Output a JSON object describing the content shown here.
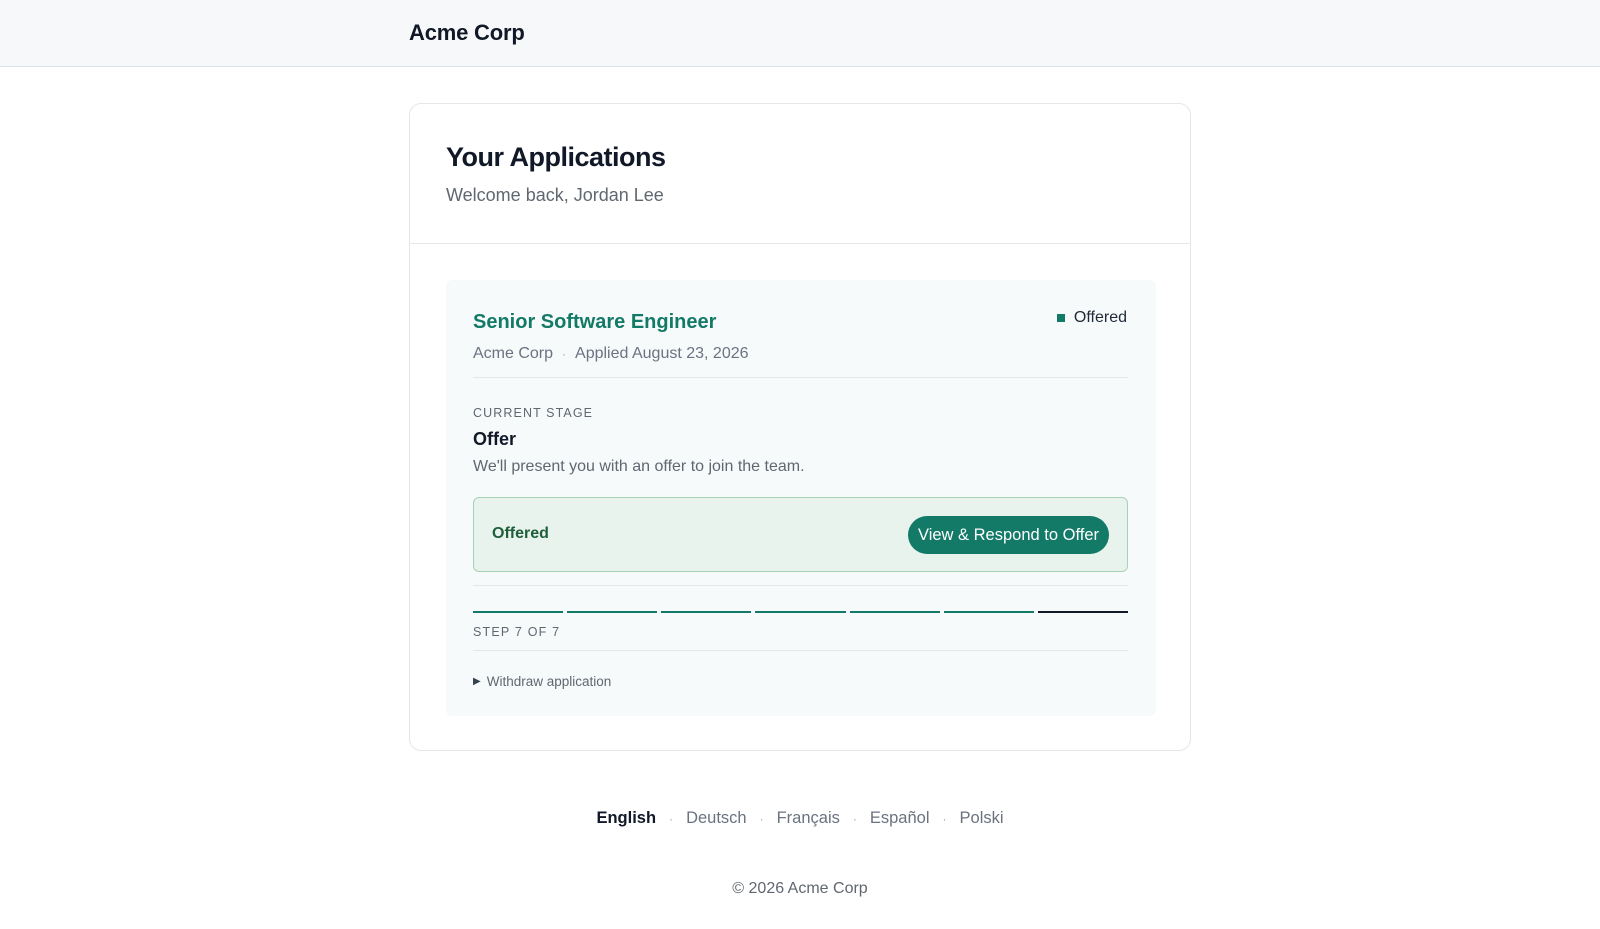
{
  "header": {
    "brand": "Acme Corp"
  },
  "main": {
    "title": "Your Applications",
    "welcome": "Welcome back, Jordan Lee"
  },
  "application": {
    "job_title": "Senior Software Engineer",
    "status": "Offered",
    "company": "Acme Corp",
    "separator": "·",
    "applied": "Applied August 23, 2026",
    "stage_label": "CURRENT STAGE",
    "stage_name": "Offer",
    "stage_description": "We'll present you with an offer to join the team.",
    "offer_status": "Offered",
    "offer_button": "View & Respond to Offer",
    "step_label": "STEP 7 OF 7",
    "progress": {
      "current": 7,
      "total": 7
    },
    "withdraw": "Withdraw application"
  },
  "footer": {
    "languages": [
      "English",
      "Deutsch",
      "Français",
      "Español",
      "Polski"
    ],
    "active_language": "English",
    "separator": "·",
    "copyright": "© 2026 Acme Corp"
  },
  "colors": {
    "accent": "#127a67",
    "offer_background": "#e9f3ed",
    "offer_border": "#a7d2b6"
  },
  "icons": {
    "status": "square-dot-icon",
    "withdraw": "disclosure-triangle-icon"
  }
}
